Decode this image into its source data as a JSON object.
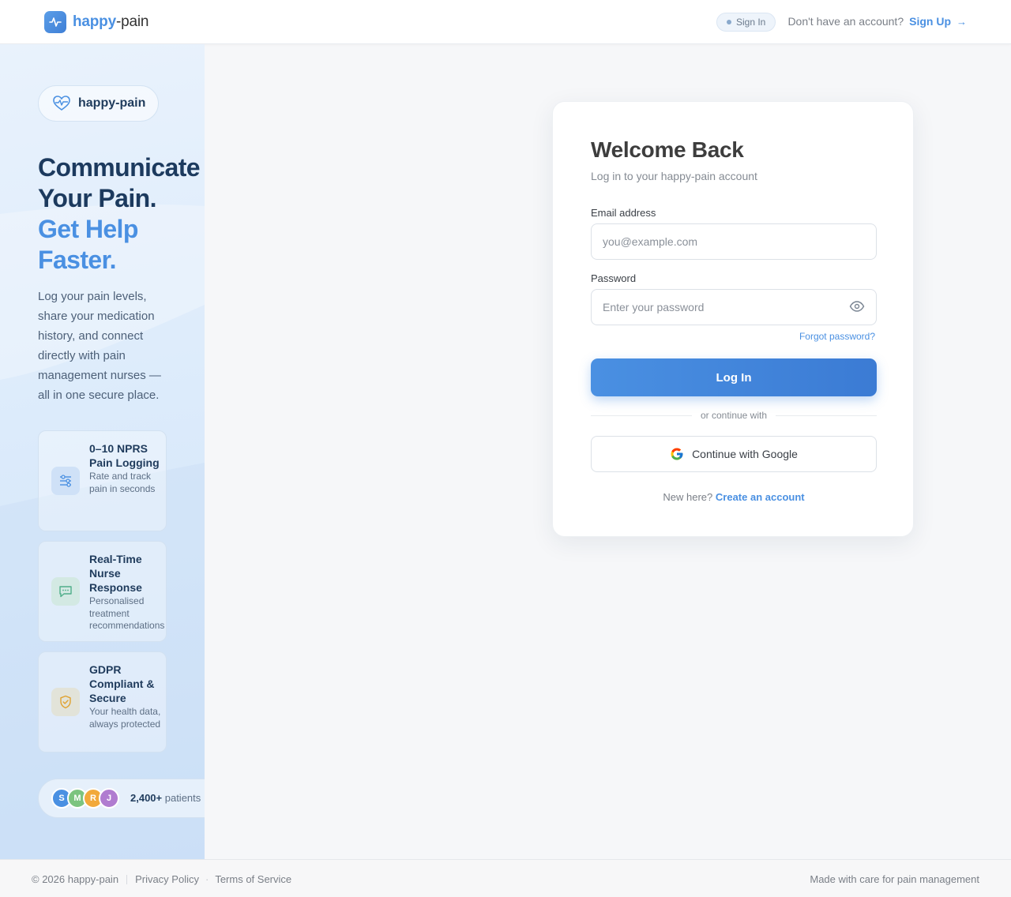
{
  "header": {
    "brand_part1": "happy",
    "brand_part2": "-pain",
    "signin_pill": "Sign In",
    "no_account_text": "Don't have an account?",
    "signup_link": "Sign Up",
    "signup_arrow": "→"
  },
  "left": {
    "badge_text": "happy-pain",
    "hero_line1": "Communicate",
    "hero_line2": "Your Pain.",
    "hero_line3": "Get Help",
    "hero_line4": "Faster.",
    "intro": "Log your pain levels, share your medication history, and connect directly with pain management nurses — all in one secure place.",
    "features": [
      {
        "title": "0–10 NPRS Pain Logging",
        "desc": "Rate and track pain in seconds",
        "icon": "sliders-icon"
      },
      {
        "title": "Real-Time Nurse Response",
        "desc": "Personalised treatment recommendations",
        "icon": "chat-icon"
      },
      {
        "title": "GDPR Compliant & Secure",
        "desc": "Your health data, always protected",
        "icon": "shield-check-icon"
      }
    ],
    "social": {
      "avatars": [
        "S",
        "M",
        "R",
        "J"
      ],
      "count": "2,400+",
      "text": " patients"
    }
  },
  "card": {
    "title": "Welcome Back",
    "subtitle": "Log in to your happy-pain account",
    "email_label": "Email address",
    "email_placeholder": "you@example.com",
    "email_value": "",
    "password_label": "Password",
    "password_placeholder": "Enter your password",
    "password_value": "",
    "forgot": "Forgot password?",
    "login_button": "Log In",
    "divider": "or continue with",
    "google_button": "Continue with Google",
    "new_here": "New here?",
    "create_account": "Create an account"
  },
  "footer": {
    "copyright": "© 2026 happy-pain",
    "privacy": "Privacy Policy",
    "dot": "·",
    "terms": "Terms of Service",
    "tagline": "Made with care for pain management"
  },
  "colors": {
    "accent": "#4a90e2",
    "navy": "#1c3a5e",
    "avatar_s": "#4a90e2",
    "avatar_m": "#7cc47f",
    "avatar_r": "#f2a93b",
    "avatar_j": "#b07cd0"
  }
}
